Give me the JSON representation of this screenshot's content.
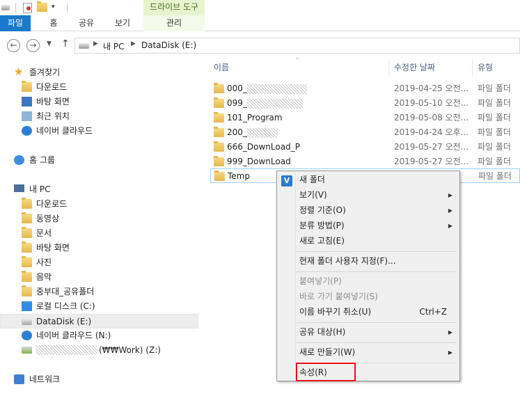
{
  "ribbon": {
    "contextual_header": "드라이브 도구",
    "tabs": [
      {
        "label": "파일"
      },
      {
        "label": "홈"
      },
      {
        "label": "공유"
      },
      {
        "label": "보기"
      },
      {
        "label": "관리"
      }
    ],
    "accent": "#1979ca"
  },
  "address": {
    "crumbs": [
      "내 PC",
      "DataDisk (E:)"
    ]
  },
  "navpane": {
    "favorites": {
      "label": "즐겨찾기",
      "items": [
        "다운로드",
        "바탕 화면",
        "최근 위치",
        "네이버 클라우드"
      ]
    },
    "homegroup": "홈 그룹",
    "thispc": {
      "label": "내 PC",
      "items": [
        "다운로드",
        "동영상",
        "문서",
        "바탕 화면",
        "사진",
        "음악",
        "중부대_공유폴더",
        "로컬 디스크 (C:)",
        "DataDisk (E:)",
        "네이버 클라우드 (N:)",
        "(₩₩Work) (Z:)"
      ]
    },
    "network": "네트워크"
  },
  "filelist": {
    "headers": {
      "name": "이름",
      "date": "수정한 날짜",
      "type": "유형"
    },
    "rows": [
      {
        "name": "000_",
        "date": "2019-04-25 오전...",
        "type": "파일 폴더"
      },
      {
        "name": "099_",
        "date": "2019-05-10 오전...",
        "type": "파일 폴더"
      },
      {
        "name": "101_Program",
        "date": "2019-05-08 오전...",
        "type": "파일 폴더"
      },
      {
        "name": "200_",
        "date": "2019-04-24 오후...",
        "type": "파일 폴더"
      },
      {
        "name": "666_DownLoad_P",
        "date": "2019-05-27 오전...",
        "type": "파일 폴더"
      },
      {
        "name": "999_DownLoad",
        "date": "2019-05-27 오전...",
        "type": "파일 폴더"
      },
      {
        "name": "Temp",
        "date": "",
        "type": "파일 폴더"
      }
    ]
  },
  "context_menu": {
    "items": [
      {
        "label": "새 폴더"
      },
      {
        "label": "보기(V)"
      },
      {
        "label": "정렬 기준(O)"
      },
      {
        "label": "분류 방법(P)"
      },
      {
        "label": "새로 고침(E)"
      },
      {
        "label": "현재 폴더 사용자 지정(F)..."
      },
      {
        "label": "붙여넣기(P)"
      },
      {
        "label": "바로 가기 붙여넣기(S)"
      },
      {
        "label": "이름 바꾸기 취소(U)",
        "shortcut": "Ctrl+Z"
      },
      {
        "label": "공유 대상(H)"
      },
      {
        "label": "새로 만들기(W)"
      },
      {
        "label": "속성(R)"
      }
    ],
    "highlight_color": "#e3131b"
  }
}
